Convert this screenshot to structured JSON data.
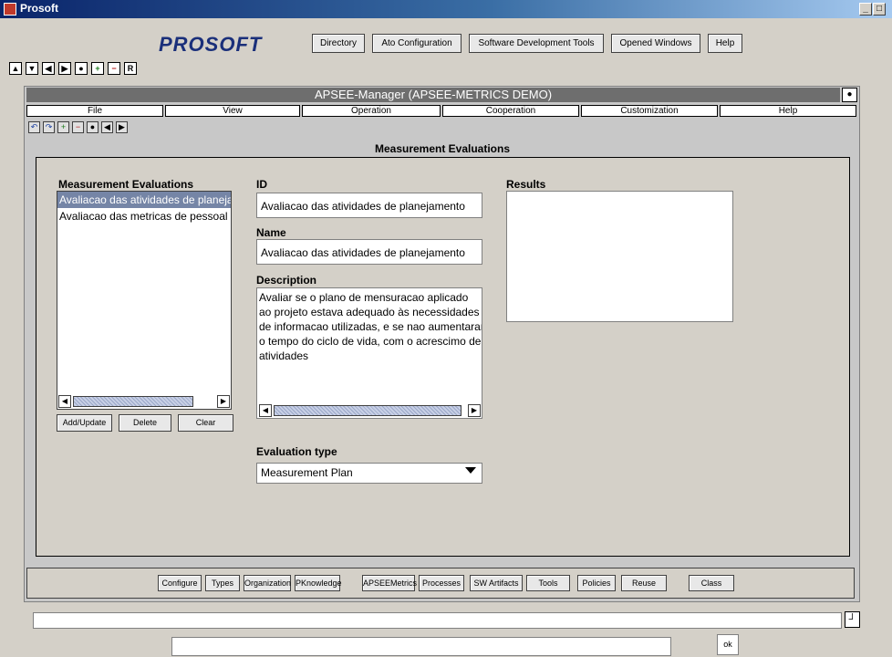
{
  "window": {
    "title": "Prosoft",
    "minimize": "_",
    "maximize": "□"
  },
  "header": {
    "logo": "PROSOFT",
    "menu": [
      "Directory",
      "Ato Configuration",
      "Software Development Tools",
      "Opened Windows",
      "Help"
    ]
  },
  "nav_icons": [
    "up-arrow-icon",
    "down-arrow-icon",
    "left-arrow-icon",
    "right-arrow-icon",
    "dot-icon",
    "plus-icon",
    "minus-icon",
    "r-icon"
  ],
  "nav_glyphs": {
    "up": "▲",
    "down": "▼",
    "left": "◀",
    "right": "▶",
    "dot": "●",
    "plus": "+",
    "minus": "−",
    "r": "R"
  },
  "inner_window": {
    "title": "APSEE-Manager (APSEE-METRICS DEMO)",
    "menu": [
      "File",
      "View",
      "Operation",
      "Cooperation",
      "Customization",
      "Help"
    ],
    "tools": [
      "↶",
      "↷",
      "+",
      "−",
      "●",
      "◀",
      "▶"
    ]
  },
  "panel": {
    "title": "Measurement Evaluations",
    "list_label": "Measurement Evaluations",
    "list_items": [
      "Avaliacao das atividades de planejamento",
      "Avaliacao das metricas de pessoal"
    ],
    "buttons": [
      "Add/Update",
      "Delete",
      "Clear"
    ],
    "id_label": "ID",
    "id_value": "Avaliacao das atividades de planejamento",
    "name_label": "Name",
    "name_value": "Avaliacao das atividades de planejamento",
    "description_label": "Description",
    "description_value": "Avaliar se o plano de mensuracao aplicado\nao projeto estava adequado às necessidades\nde informacao utilizadas, e se nao aumentaram\no tempo do ciclo de vida, com o acrescimo de\natividades",
    "results_label": "Results",
    "eval_type_label": "Evaluation type",
    "eval_type_value": "Measurement Plan"
  },
  "bottom_toolbar": [
    "Configure",
    "Types",
    "Organization",
    "PKnowledge",
    "APSEEMetrics",
    "Processes",
    "SW Artifacts",
    "Tools",
    "Policies",
    "Reuse",
    "Class"
  ],
  "ok_label": "ok"
}
